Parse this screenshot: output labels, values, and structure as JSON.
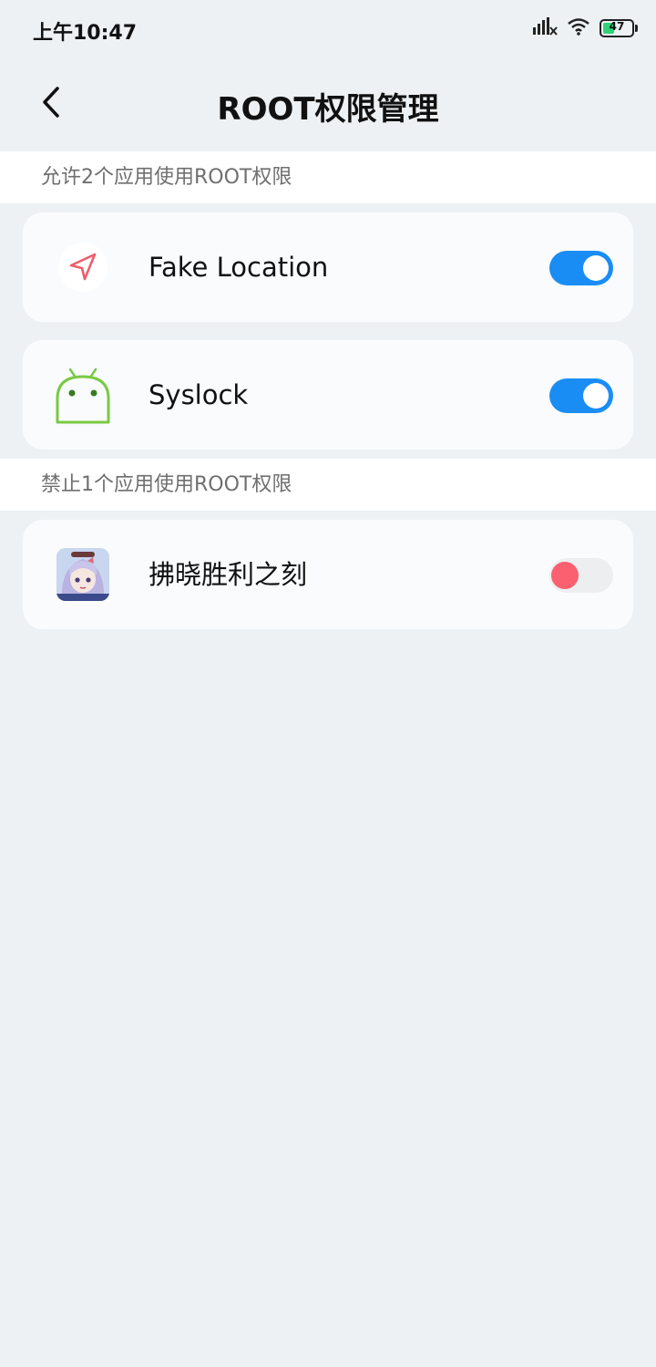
{
  "status_bar": {
    "time": "上午10:47",
    "battery_level": "47",
    "battery_fraction": 0.47,
    "icons": [
      "signal-icon",
      "wifi-icon",
      "battery-icon"
    ]
  },
  "header": {
    "title": "ROOT权限管理",
    "back_icon": "chevron-left-icon"
  },
  "allowed_section": {
    "label": "允许2个应用使用ROOT权限",
    "apps": [
      {
        "name": "Fake Location",
        "icon": "location-arrow-icon",
        "enabled": true
      },
      {
        "name": "Syslock",
        "icon": "android-icon",
        "enabled": true
      }
    ]
  },
  "denied_section": {
    "label": "禁止1个应用使用ROOT权限",
    "apps": [
      {
        "name": "拂晓胜利之刻",
        "icon": "game-avatar-icon",
        "enabled": false
      }
    ]
  },
  "colors": {
    "toggle_on": "#1a8df5",
    "toggle_off_knob": "#fa6070",
    "background": "#edf1f4",
    "card": "#f9fbfd"
  }
}
